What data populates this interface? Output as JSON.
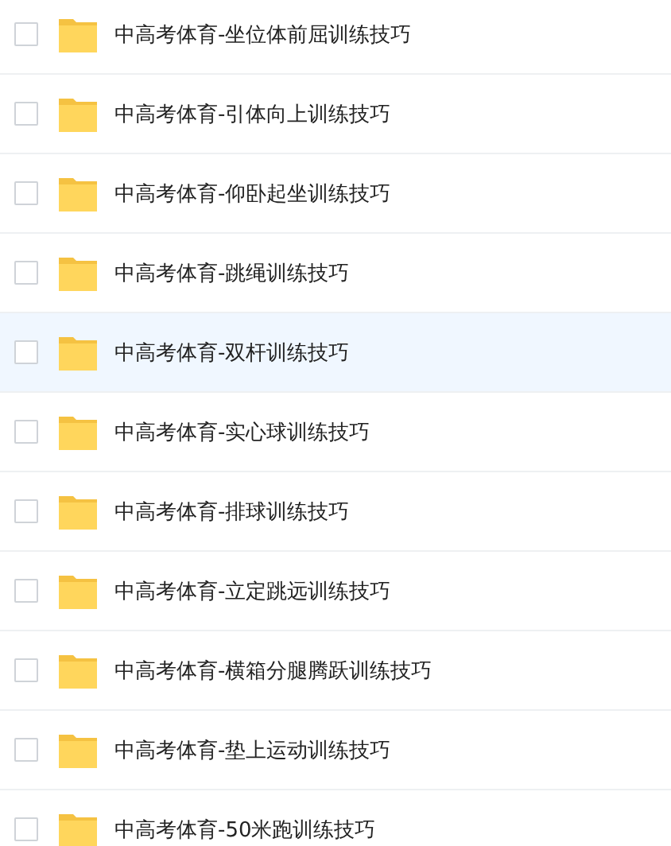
{
  "files": [
    {
      "name": "中高考体育-坐位体前屈训练技巧",
      "checked": false,
      "highlighted": false
    },
    {
      "name": "中高考体育-引体向上训练技巧",
      "checked": false,
      "highlighted": false
    },
    {
      "name": "中高考体育-仰卧起坐训练技巧",
      "checked": false,
      "highlighted": false
    },
    {
      "name": "中高考体育-跳绳训练技巧",
      "checked": false,
      "highlighted": false
    },
    {
      "name": "中高考体育-双杆训练技巧",
      "checked": false,
      "highlighted": true
    },
    {
      "name": "中高考体育-实心球训练技巧",
      "checked": false,
      "highlighted": false
    },
    {
      "name": "中高考体育-排球训练技巧",
      "checked": false,
      "highlighted": false
    },
    {
      "name": "中高考体育-立定跳远训练技巧",
      "checked": false,
      "highlighted": false
    },
    {
      "name": "中高考体育-横箱分腿腾跃训练技巧",
      "checked": false,
      "highlighted": false
    },
    {
      "name": "中高考体育-垫上运动训练技巧",
      "checked": false,
      "highlighted": false
    },
    {
      "name": "中高考体育-50米跑训练技巧",
      "checked": false,
      "highlighted": false
    }
  ]
}
